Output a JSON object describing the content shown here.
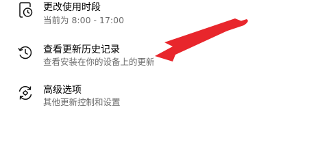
{
  "items": [
    {
      "icon": "clock-alarm-icon",
      "title": "更改使用时段",
      "subtitle": "当前为 8:00 - 17:00"
    },
    {
      "icon": "history-icon",
      "title": "查看更新历史记录",
      "subtitle": "查看安装在你的设备上的更新"
    },
    {
      "icon": "sync-gear-icon",
      "title": "高级选项",
      "subtitle": "其他更新控制和设置"
    }
  ],
  "colors": {
    "title": "#000000",
    "subtitle": "#6b6b6b",
    "annotation_arrow": "#e8262c"
  }
}
